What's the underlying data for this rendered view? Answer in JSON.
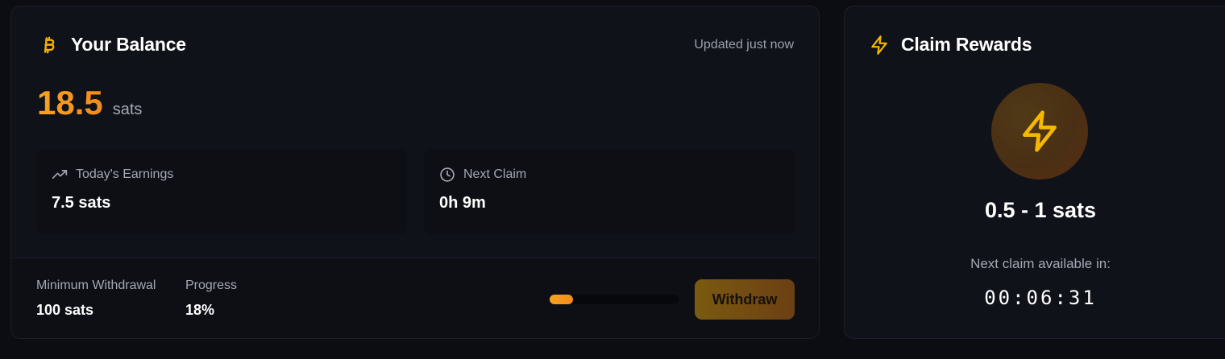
{
  "balance_card": {
    "title": "Your Balance",
    "title_icon": "bitcoin-icon",
    "updated": "Updated just now",
    "amount": "18.5",
    "unit": "sats",
    "stats": [
      {
        "icon": "trending-up-icon",
        "label": "Today's Earnings",
        "value": "7.5 sats"
      },
      {
        "icon": "clock-icon",
        "label": "Next Claim",
        "value": "0h 9m"
      }
    ],
    "footer": {
      "min_label": "Minimum Withdrawal",
      "min_value": "100 sats",
      "progress_label": "Progress",
      "progress_value": "18%",
      "progress_fraction": 0.18,
      "withdraw_label": "Withdraw"
    }
  },
  "claim_card": {
    "title": "Claim Rewards",
    "title_icon": "lightning-icon",
    "center_icon": "lightning-icon",
    "reward_range": "0.5 - 1 sats",
    "next_label": "Next claim available in:",
    "countdown": "00:06:31"
  },
  "colors": {
    "accent_orange": "#f7a321",
    "accent_yellow": "#f5b800",
    "background": "#0c0d12",
    "card": "#10121a"
  }
}
